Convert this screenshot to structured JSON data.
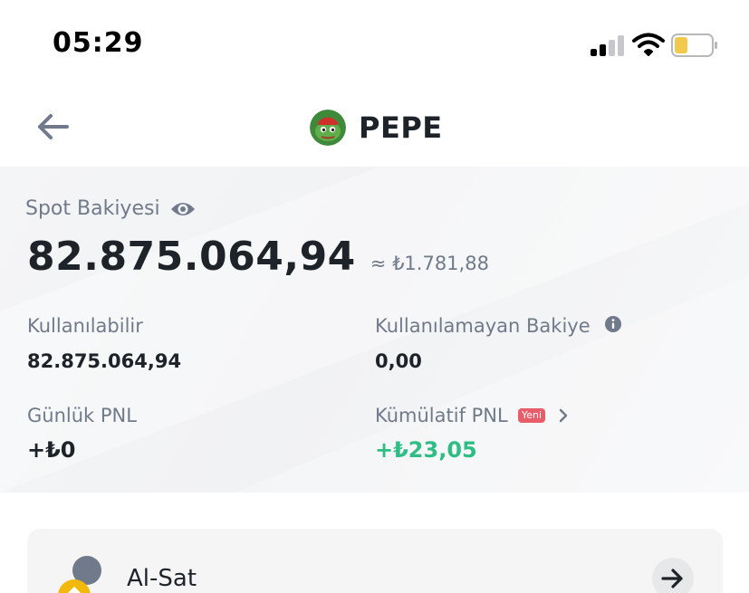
{
  "status_bar": {
    "time": "05:29",
    "signal_icon": "cellular-signal-icon",
    "wifi_icon": "wifi-icon",
    "battery_icon": "battery-icon",
    "battery_color": "#f2c94c"
  },
  "header": {
    "back_icon": "back-arrow-icon",
    "coin_name": "PEPE",
    "coin_avatar_icon": "pepe-frog-avatar"
  },
  "balance": {
    "spot_label": "Spot Bakiyesi",
    "eye_icon": "eye-icon",
    "amount": "82.875.064,94",
    "approx_value": "≈ ₺1.781,88",
    "available_label": "Kullanılabilir",
    "available_value": "82.875.064,94",
    "unavailable_label": "Kullanılamayan Bakiye",
    "unavailable_value": "0,00",
    "daily_pnl_label": "Günlük PNL",
    "daily_pnl_value": "+₺0",
    "cumulative_pnl_label": "Kümülatif PNL",
    "new_badge": "Yeni",
    "cumulative_pnl_value": "+₺23,05"
  },
  "trade": {
    "label": "Al-Sat",
    "arrow_icon": "arrow-right-icon"
  },
  "colors": {
    "positive": "#2ebd85",
    "muted": "#707a8a",
    "text": "#1e2329",
    "badge": "#e85d6a",
    "coin_yellow": "#f0b90b"
  }
}
